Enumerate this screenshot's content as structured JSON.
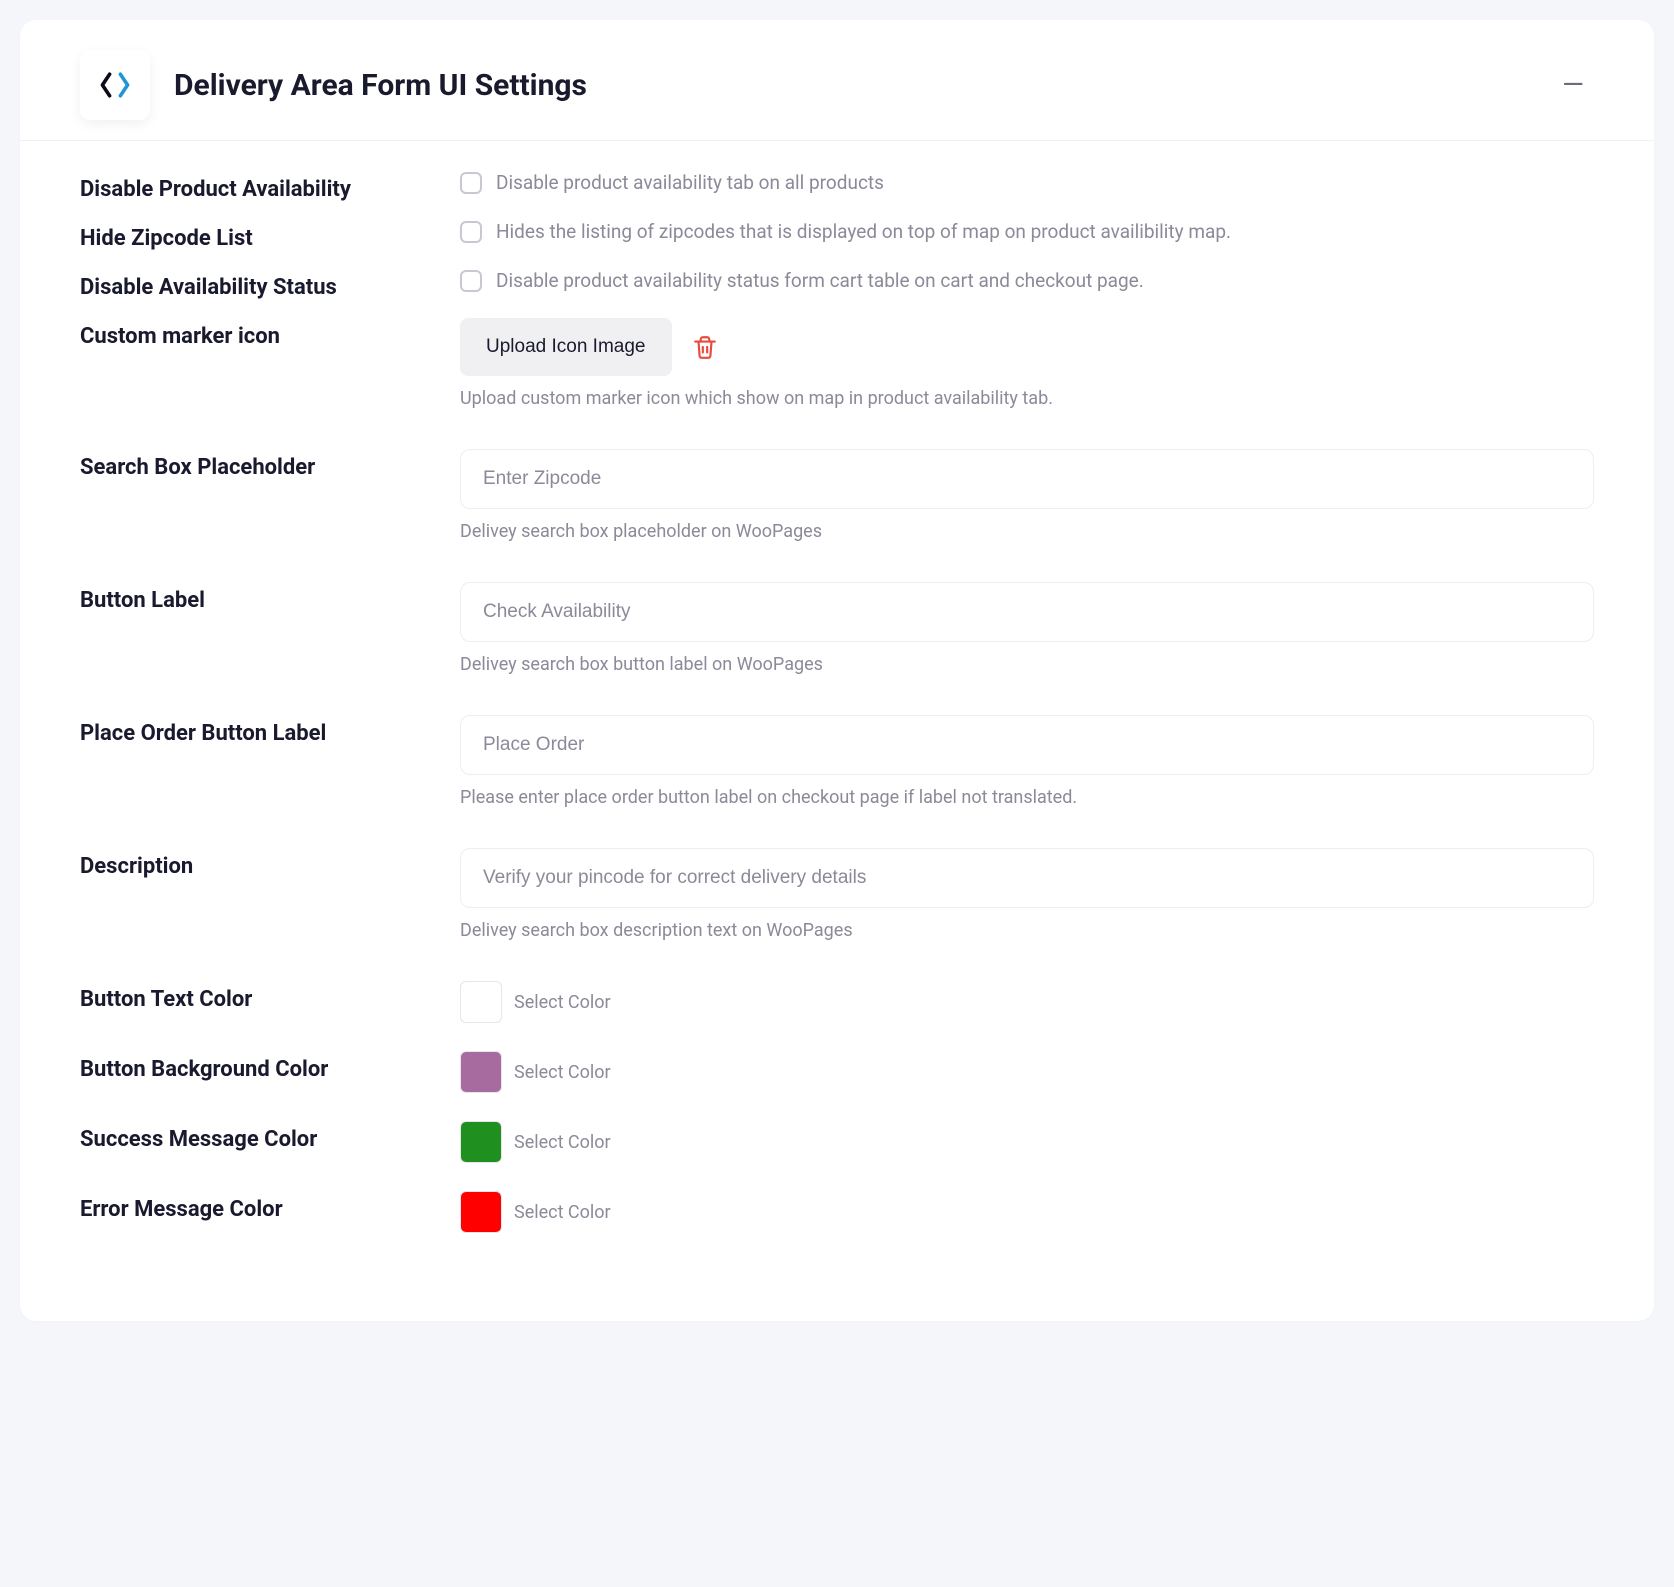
{
  "header": {
    "title": "Delivery Area Form UI Settings"
  },
  "fields": {
    "disable_product_availability": {
      "label": "Disable Product Availability",
      "description": "Disable product availability tab on all products"
    },
    "hide_zipcode_list": {
      "label": "Hide Zipcode List",
      "description": "Hides the listing of zipcodes that is displayed on top of map on product availibility map."
    },
    "disable_availability_status": {
      "label": "Disable Availability Status",
      "description": "Disable product availability status form cart table on cart and checkout page."
    },
    "custom_marker_icon": {
      "label": "Custom marker icon",
      "button": "Upload Icon Image",
      "help": "Upload custom marker icon which show on map in product availability tab."
    },
    "search_box_placeholder": {
      "label": "Search Box Placeholder",
      "value": "Enter Zipcode",
      "help": "Delivey search box placeholder on WooPages"
    },
    "button_label": {
      "label": "Button Label",
      "value": "Check Availability",
      "help": "Delivey search box button label on WooPages"
    },
    "place_order_button_label": {
      "label": "Place Order Button Label",
      "value": "Place Order",
      "help": "Please enter place order button label on checkout page if label not translated."
    },
    "description": {
      "label": "Description",
      "value": "Verify your pincode for correct delivery details",
      "help": "Delivey search box description text on WooPages"
    },
    "button_text_color": {
      "label": "Button Text Color",
      "swatch": "#ffffff",
      "select": "Select Color"
    },
    "button_background_color": {
      "label": "Button Background Color",
      "swatch": "#a86ba0",
      "select": "Select Color"
    },
    "success_message_color": {
      "label": "Success Message Color",
      "swatch": "#1f8f1f",
      "select": "Select Color"
    },
    "error_message_color": {
      "label": "Error Message Color",
      "swatch": "#ff0000",
      "select": "Select Color"
    }
  }
}
